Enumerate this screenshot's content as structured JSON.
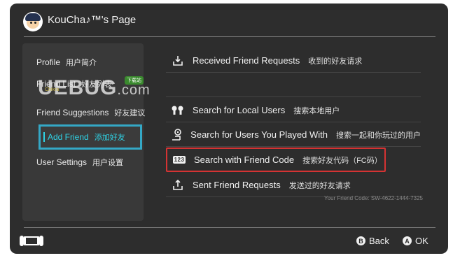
{
  "header": {
    "title": "KouCha♪™'s Page"
  },
  "sidebar": {
    "items": [
      {
        "label": "Profile",
        "cn": "用户简介"
      },
      {
        "label": "Friend List",
        "cn": "好友列表"
      },
      {
        "label": "Friend Suggestions",
        "cn": "好友建议"
      },
      {
        "label": "Add Friend",
        "cn": "添加好友"
      },
      {
        "label": "User Settings",
        "cn": "用户设置"
      }
    ]
  },
  "main": {
    "rows": [
      {
        "icon": "inbox-download-icon",
        "label": "Received Friend Requests",
        "cn": "收到的好友请求"
      },
      {
        "icon": "local-users-icon",
        "label": "Search for Local Users",
        "cn": "搜索本地用户"
      },
      {
        "icon": "played-with-icon",
        "label": "Search for Users You Played With",
        "cn": "搜索一起和你玩过的用户"
      },
      {
        "icon": "friend-code-icon",
        "badge": "123",
        "label": "Search with Friend Code",
        "cn": "搜索好友代码（FC码）"
      },
      {
        "icon": "outbox-upload-icon",
        "label": "Sent Friend Requests",
        "cn": "发送过的好友请求"
      }
    ],
    "friend_code": "Your Friend Code: SW-4622-1444-7325"
  },
  "footer": {
    "back_glyph": "B",
    "back_label": "Back",
    "ok_glyph": "A",
    "ok_label": "OK"
  },
  "watermark": {
    "brand": "UEBUG",
    "suffix": ".com",
    "tag": "下载站",
    "sub": "Chikra"
  },
  "colors": {
    "background": "#2d2d2d",
    "accent": "#2fd3e6",
    "highlight_border": "#d43333"
  }
}
